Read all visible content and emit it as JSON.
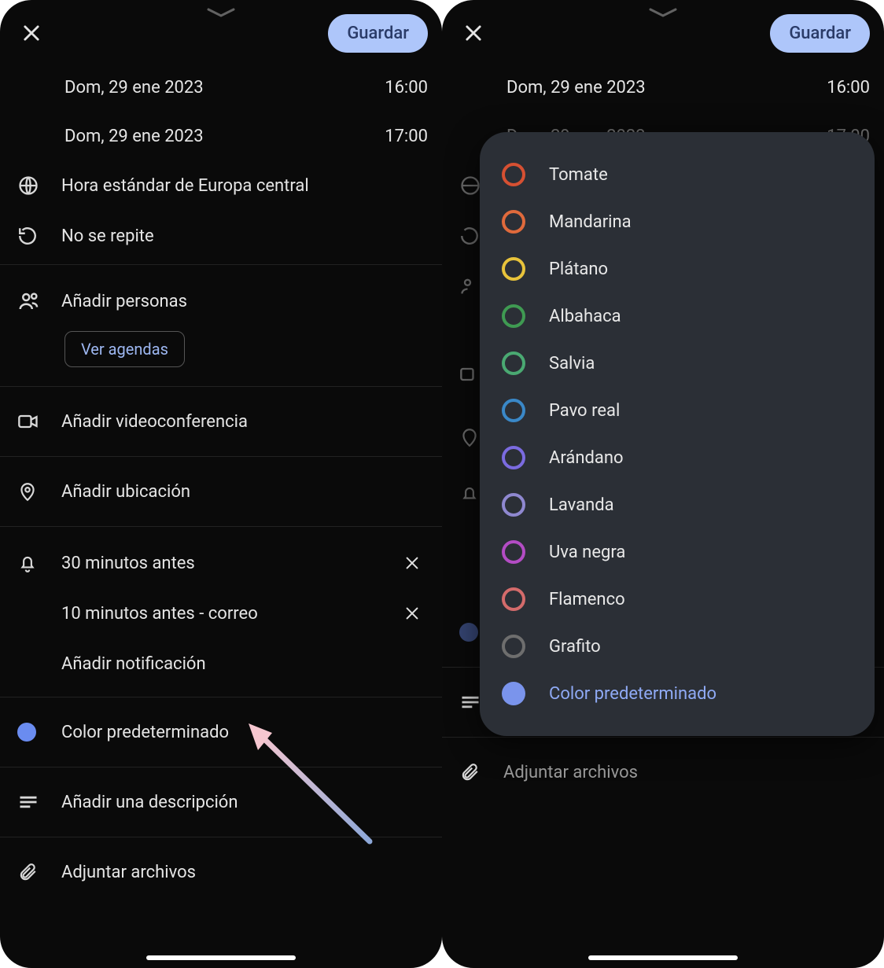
{
  "common": {
    "save_label": "Guardar",
    "start_date": "Dom, 29 ene 2023",
    "start_time": "16:00",
    "end_date": "Dom, 29 ene 2023",
    "end_time": "17:00",
    "timezone_label": "Hora estándar de Europa central",
    "repeat_label": "No se repite",
    "add_people_label": "Añadir personas",
    "view_schedules_label": "Ver agendas",
    "add_video_label": "Añadir videoconferencia",
    "add_location_label": "Añadir ubicación",
    "reminder1_label": "30 minutos antes",
    "reminder2_label": "10 minutos antes - correo",
    "add_notification_label": "Añadir notificación",
    "default_color_label": "Color predeterminado",
    "add_description_label": "Añadir una descripción",
    "attach_files_label": "Adjuntar archivos"
  },
  "color_picker": {
    "items": [
      {
        "label": "Tomate",
        "color": "#d65032"
      },
      {
        "label": "Mandarina",
        "color": "#e06a3c"
      },
      {
        "label": "Plátano",
        "color": "#e8c33b"
      },
      {
        "label": "Albahaca",
        "color": "#3f9a52"
      },
      {
        "label": "Salvia",
        "color": "#4aa972"
      },
      {
        "label": "Pavo real",
        "color": "#3a88c8"
      },
      {
        "label": "Arándano",
        "color": "#7b6be0"
      },
      {
        "label": "Lavanda",
        "color": "#8f88d0"
      },
      {
        "label": "Uva negra",
        "color": "#b34cc4"
      },
      {
        "label": "Flamenco",
        "color": "#d46b6b"
      },
      {
        "label": "Grafito",
        "color": "#6e6e6e"
      }
    ],
    "selected": {
      "label": "Color predeterminado",
      "color": "#7a94ec"
    }
  }
}
